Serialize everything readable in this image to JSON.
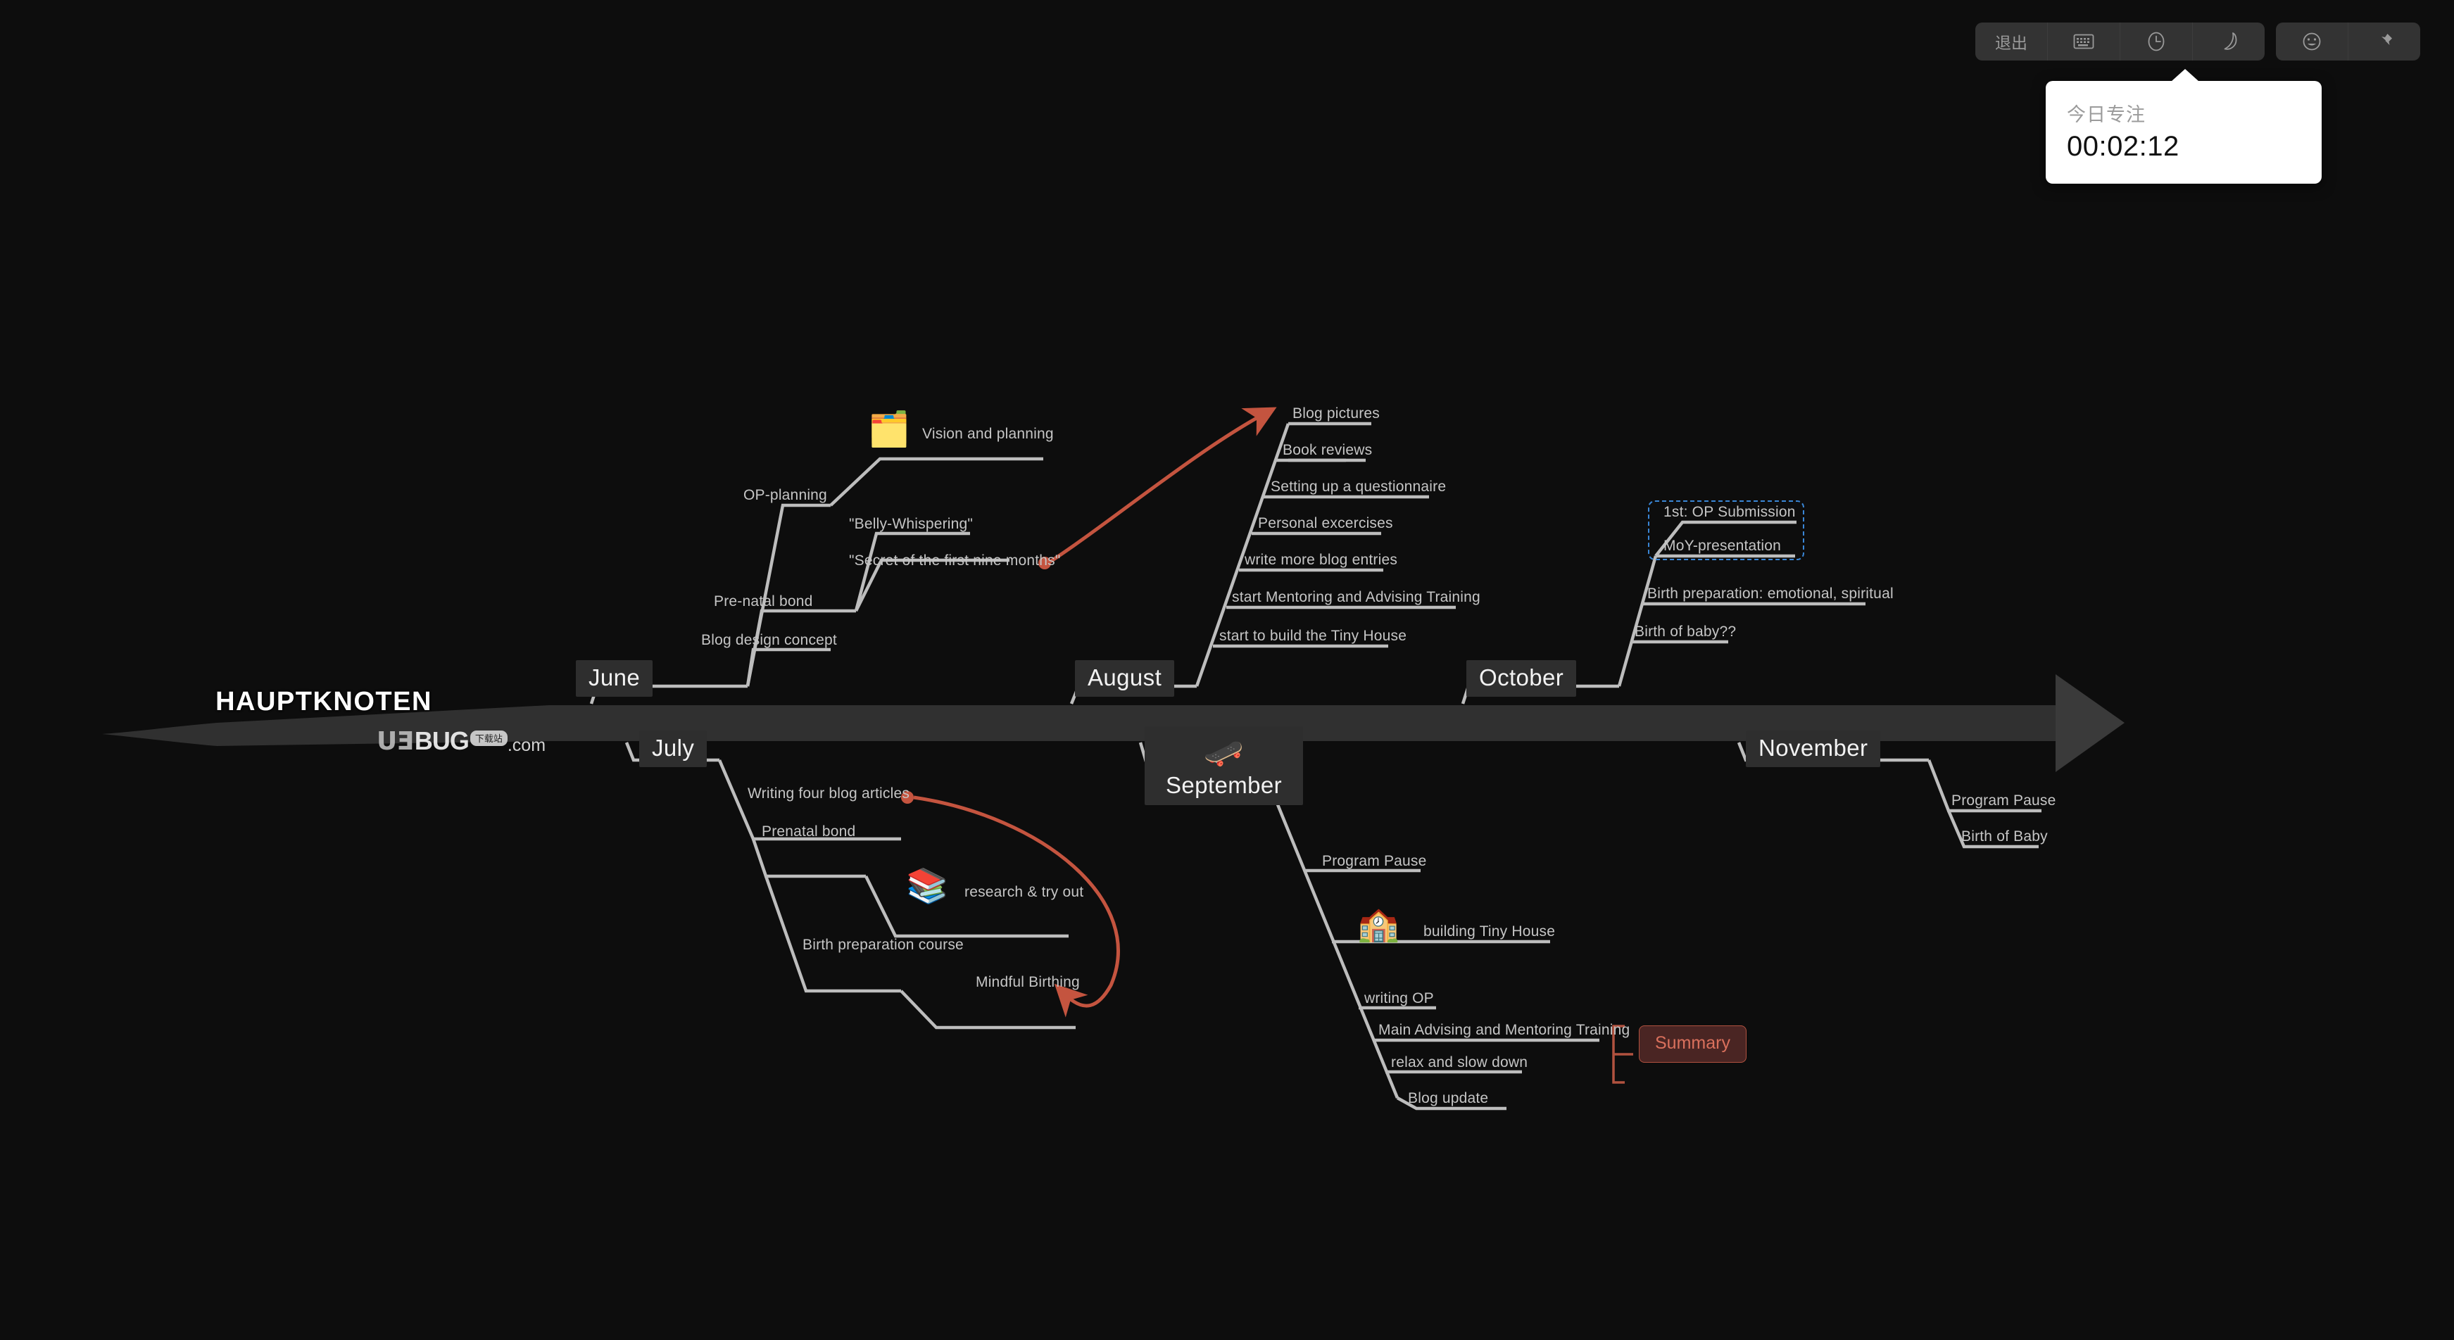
{
  "toolbar": {
    "groups": [
      {
        "name": "primary",
        "buttons": [
          {
            "id": "exit",
            "label": "退出",
            "icon": "text"
          },
          {
            "id": "keyboard",
            "label": "",
            "icon": "keyboard-icon"
          },
          {
            "id": "timer",
            "label": "",
            "icon": "clock-icon"
          },
          {
            "id": "night",
            "label": "",
            "icon": "moon-icon"
          }
        ]
      },
      {
        "name": "secondary",
        "buttons": [
          {
            "id": "emoji",
            "label": "",
            "icon": "smiley-icon"
          },
          {
            "id": "pin",
            "label": "",
            "icon": "pin-icon"
          }
        ]
      }
    ]
  },
  "focus_tooltip": {
    "label": "今日专注",
    "time": "00:02:12"
  },
  "mindmap": {
    "root": {
      "title": "HAUPTKNOTEN"
    },
    "watermark": {
      "ue": "UƎ",
      "bug": "BUG",
      "badge": "下载站",
      "com": ".com"
    },
    "dashed_group_color": "#3a86d6",
    "accent_red": "#c4543f",
    "months": [
      {
        "name": "June",
        "side": "top",
        "children": [
          {
            "label": "OP-planning",
            "children": [
              {
                "label": "Vision and planning",
                "icon": "memo-folder-icon"
              }
            ]
          },
          {
            "label": "Pre-natal bond",
            "children": [
              {
                "label": "\"Belly-Whispering\""
              },
              {
                "label": "\"Secret of the first nine months\""
              }
            ]
          },
          {
            "label": "Blog design concept"
          }
        ]
      },
      {
        "name": "August",
        "side": "top",
        "children": [
          {
            "label": "Blog pictures"
          },
          {
            "label": "Book reviews"
          },
          {
            "label": "Setting up a questionnaire"
          },
          {
            "label": "Personal excercises"
          },
          {
            "label": "write more blog entries"
          },
          {
            "label": "start Mentoring and Advising Training"
          },
          {
            "label": "start to build the Tiny House"
          }
        ]
      },
      {
        "name": "October",
        "side": "top",
        "children": [
          {
            "label": "1st: OP Submission",
            "grouped": true
          },
          {
            "label": "MoY-presentation",
            "grouped": true
          },
          {
            "label": "Birth preparation: emotional, spiritual"
          },
          {
            "label": "Birth of baby??"
          }
        ]
      },
      {
        "name": "July",
        "side": "bottom",
        "children": [
          {
            "label": "Writing four blog articles"
          },
          {
            "label": "Prenatal bond",
            "children": [
              {
                "label": "research & try out",
                "icon": "books-icon"
              }
            ]
          },
          {
            "label": "Birth preparation course",
            "children": [
              {
                "label": "Mindful Birthing"
              }
            ]
          }
        ]
      },
      {
        "name": "September",
        "side": "bottom",
        "icon": "skateboard-icon",
        "children": [
          {
            "label": "Program Pause"
          },
          {
            "label": "building Tiny House",
            "icon": "house-icon"
          },
          {
            "label": "writing OP"
          },
          {
            "label": "Main Advising and Mentoring Training",
            "bracketed": true
          },
          {
            "label": "relax and slow down",
            "bracketed": true
          },
          {
            "label": "Blog update"
          }
        ]
      },
      {
        "name": "November",
        "side": "bottom",
        "children": [
          {
            "label": "Program Pause"
          },
          {
            "label": "Birth of Baby"
          }
        ]
      }
    ],
    "summary_badge": "Summary"
  }
}
